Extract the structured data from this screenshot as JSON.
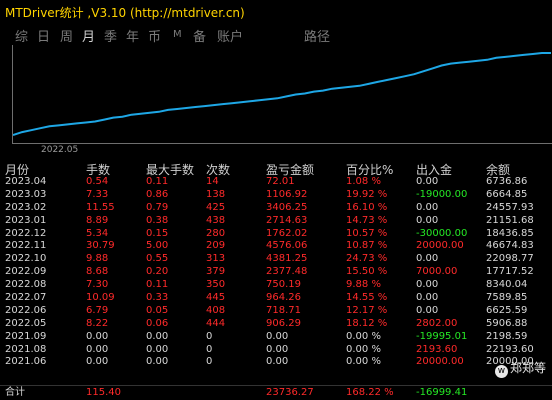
{
  "app": {
    "title": "MTDriver统计 ,V3.10 (http://mtdriver.cn)"
  },
  "tabs": [
    {
      "label": "综",
      "active": false
    },
    {
      "label": "日",
      "active": false
    },
    {
      "label": "周",
      "active": false
    },
    {
      "label": "月",
      "active": true
    },
    {
      "label": "季",
      "active": false
    },
    {
      "label": "年",
      "active": false
    },
    {
      "label": "币",
      "active": false
    },
    {
      "label": "M",
      "active": false
    },
    {
      "label": "备",
      "active": false
    },
    {
      "label": "账户",
      "active": false
    },
    {
      "label": "路径",
      "active": false
    }
  ],
  "chart": {
    "x_tick": "2022.05",
    "line_color": "#1ea7e6",
    "series": [
      0,
      3,
      5,
      7,
      9,
      10,
      11,
      12,
      13,
      14,
      16,
      18,
      19,
      21,
      22,
      23,
      24,
      26,
      27,
      28,
      29,
      30,
      31,
      32,
      33,
      34,
      35,
      36,
      37,
      38,
      40,
      42,
      43,
      45,
      46,
      48,
      49,
      50,
      51,
      53,
      55,
      57,
      59,
      61,
      63,
      66,
      69,
      72,
      74,
      75,
      76,
      77,
      78,
      80,
      81,
      82,
      83,
      84,
      85,
      85
    ]
  },
  "colors": {
    "red": "#ff2a2a",
    "green": "#25e825",
    "white": "#d8d8d8",
    "header": "#d0d0d0"
  },
  "table": {
    "headers": [
      "月份",
      "手数",
      "最大手数",
      "次数",
      "盈亏金额",
      "百分比%",
      "出入金",
      "余额"
    ],
    "rows": [
      {
        "cells": [
          "2023.04",
          "0.54",
          "0.11",
          "14",
          "72.01",
          "1.08 %",
          "0.00",
          "6736.86"
        ],
        "io": "white",
        "red": true
      },
      {
        "cells": [
          "2023.03",
          "7.33",
          "0.86",
          "138",
          "1106.92",
          "19.92 %",
          "-19000.00",
          "6664.85"
        ],
        "io": "green",
        "red": true
      },
      {
        "cells": [
          "2023.02",
          "11.55",
          "0.79",
          "425",
          "3406.25",
          "16.10 %",
          "0.00",
          "24557.93"
        ],
        "io": "white",
        "red": true
      },
      {
        "cells": [
          "2023.01",
          "8.89",
          "0.38",
          "438",
          "2714.63",
          "14.73 %",
          "0.00",
          "21151.68"
        ],
        "io": "white",
        "red": true
      },
      {
        "cells": [
          "2022.12",
          "5.34",
          "0.15",
          "280",
          "1762.02",
          "10.57 %",
          "-30000.00",
          "18436.85"
        ],
        "io": "green",
        "red": true
      },
      {
        "cells": [
          "2022.11",
          "30.79",
          "5.00",
          "209",
          "4576.06",
          "10.87 %",
          "20000.00",
          "46674.83"
        ],
        "io": "red",
        "red": true
      },
      {
        "cells": [
          "2022.10",
          "9.88",
          "0.55",
          "313",
          "4381.25",
          "24.73 %",
          "0.00",
          "22098.77"
        ],
        "io": "white",
        "red": true
      },
      {
        "cells": [
          "2022.09",
          "8.68",
          "0.20",
          "379",
          "2377.48",
          "15.50 %",
          "7000.00",
          "17717.52"
        ],
        "io": "red",
        "red": true
      },
      {
        "cells": [
          "2022.08",
          "7.30",
          "0.11",
          "350",
          "750.19",
          "9.88 %",
          "0.00",
          "8340.04"
        ],
        "io": "white",
        "red": true
      },
      {
        "cells": [
          "2022.07",
          "10.09",
          "0.33",
          "445",
          "964.26",
          "14.55 %",
          "0.00",
          "7589.85"
        ],
        "io": "white",
        "red": true
      },
      {
        "cells": [
          "2022.06",
          "6.79",
          "0.05",
          "408",
          "718.71",
          "12.17 %",
          "0.00",
          "6625.59"
        ],
        "io": "white",
        "red": true
      },
      {
        "cells": [
          "2022.05",
          "8.22",
          "0.06",
          "444",
          "906.29",
          "18.12 %",
          "2802.00",
          "5906.88"
        ],
        "io": "red",
        "red": true
      },
      {
        "cells": [
          "2021.09",
          "0.00",
          "0.00",
          "0",
          "0.00",
          "0.00 %",
          "-19995.01",
          "2198.59"
        ],
        "io": "green",
        "red": false
      },
      {
        "cells": [
          "2021.08",
          "0.00",
          "0.00",
          "0",
          "0.00",
          "0.00 %",
          "2193.60",
          "22193.60"
        ],
        "io": "red",
        "red": false
      },
      {
        "cells": [
          "2021.06",
          "0.00",
          "0.00",
          "0",
          "0.00",
          "0.00 %",
          "20000.00",
          "20000.00"
        ],
        "io": "red",
        "red": false
      }
    ],
    "total": {
      "cells": [
        "合计",
        "115.40",
        "",
        "",
        "23736.27",
        "168.22 %",
        "-16999.41",
        ""
      ]
    }
  },
  "watermark": {
    "icon": "weibo-icon",
    "text": "郑郑等"
  }
}
